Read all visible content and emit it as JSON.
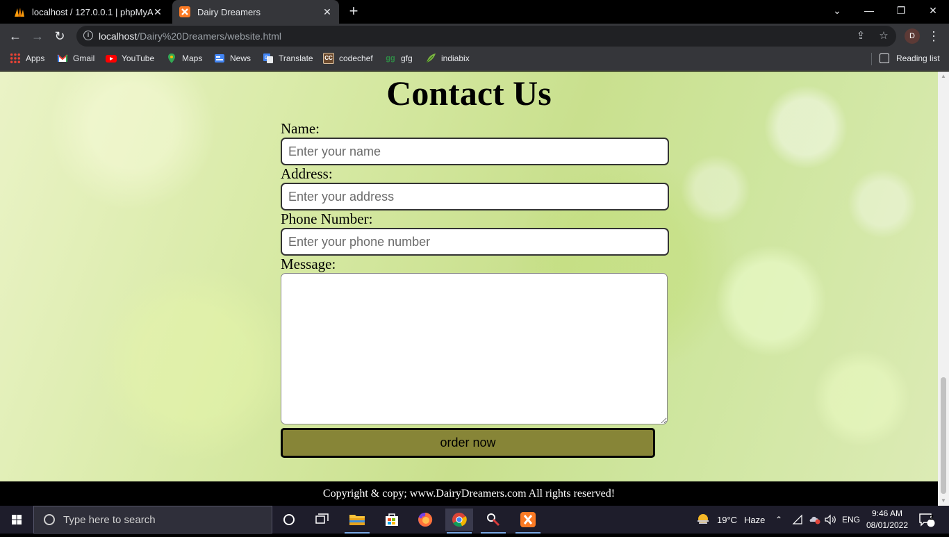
{
  "browser": {
    "tabs": [
      {
        "title": "localhost / 127.0.0.1 | phpMyAdmin",
        "active": false,
        "icon": "phpmyadmin-icon"
      },
      {
        "title": "Dairy Dreamers",
        "active": true,
        "icon": "xampp-icon"
      }
    ],
    "address": {
      "host": "localhost",
      "path": "/Dairy%20Dreamers/website.html"
    },
    "profile_initial": "D",
    "bookmarks": [
      {
        "label": "Apps",
        "icon": "apps-icon"
      },
      {
        "label": "Gmail",
        "icon": "gmail-icon"
      },
      {
        "label": "YouTube",
        "icon": "youtube-icon"
      },
      {
        "label": "Maps",
        "icon": "maps-icon"
      },
      {
        "label": "News",
        "icon": "news-icon"
      },
      {
        "label": "Translate",
        "icon": "translate-icon"
      },
      {
        "label": "codechef",
        "icon": "codechef-icon"
      },
      {
        "label": "gfg",
        "icon": "gfg-icon"
      },
      {
        "label": "indiabix",
        "icon": "indiabix-icon"
      }
    ],
    "reading_list": "Reading list"
  },
  "page": {
    "title": "Contact Us",
    "form": {
      "name_label": "Name:",
      "name_placeholder": "Enter your name",
      "address_label": "Address:",
      "address_placeholder": "Enter your address",
      "phone_label": "Phone Number:",
      "phone_placeholder": "Enter your phone number",
      "message_label": "Message:",
      "submit_label": "order now"
    },
    "footer": "Copyright & copy; www.DairyDreamers.com All rights reserved!"
  },
  "taskbar": {
    "search_placeholder": "Type here to search",
    "weather": {
      "temp": "19°C",
      "condition": "Haze"
    },
    "language": "ENG",
    "time": "9:46 AM",
    "date": "08/01/2022",
    "notification_count": "2"
  },
  "colors": {
    "button_fill": "#878537",
    "chrome_dark": "#35363a",
    "taskbar": "#1e1d2b"
  }
}
